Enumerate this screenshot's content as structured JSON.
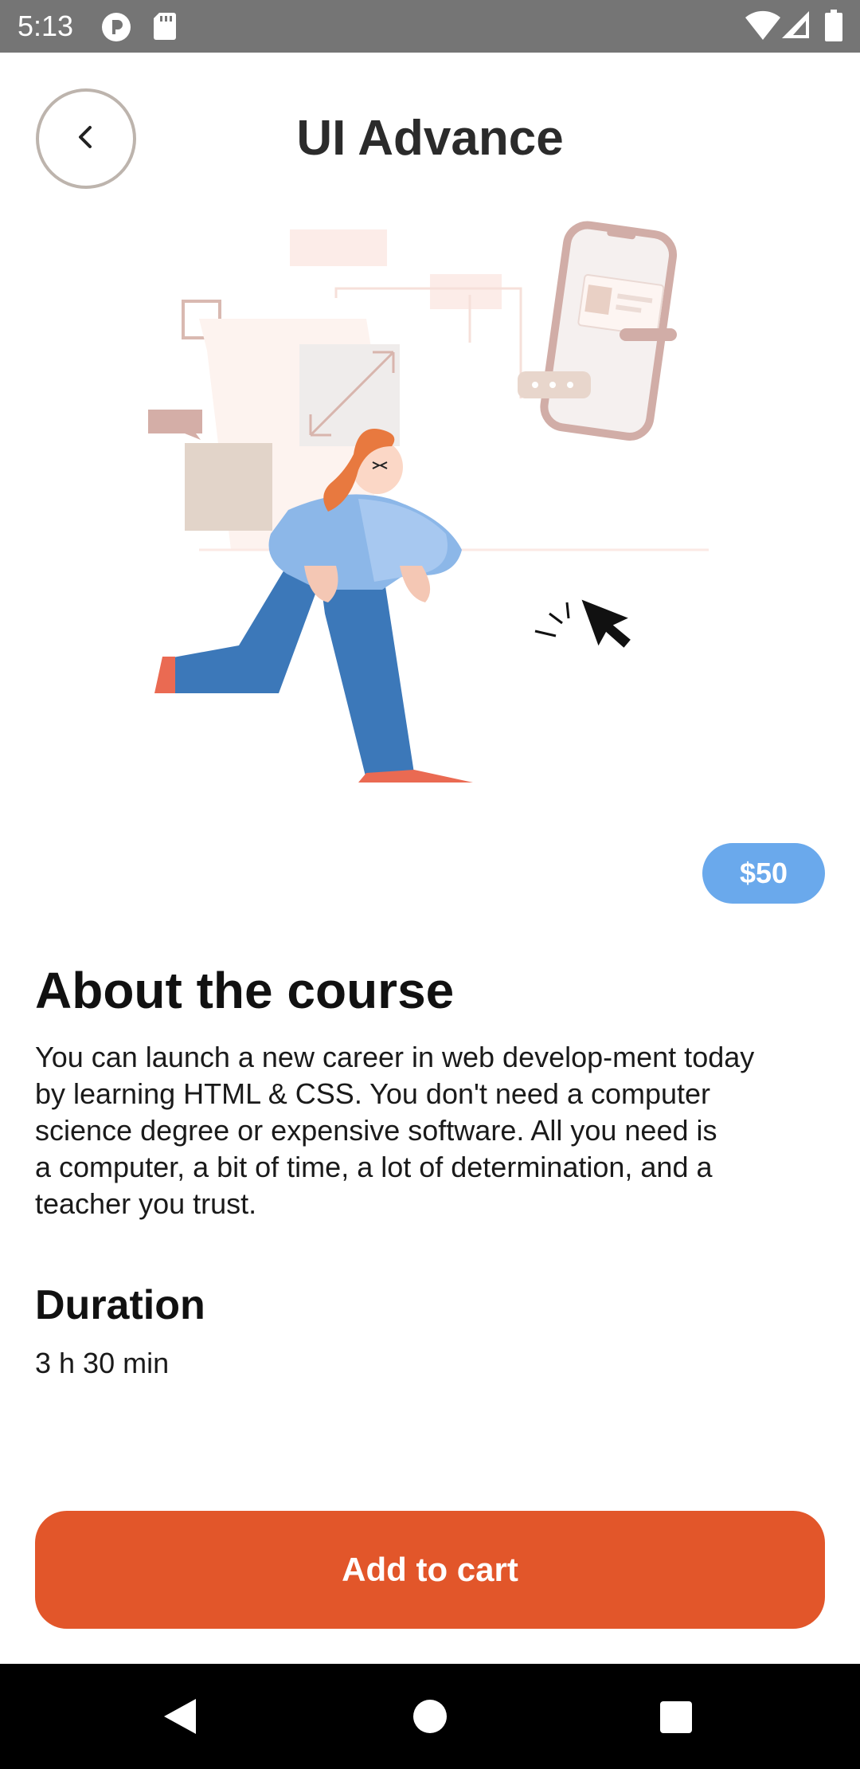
{
  "status_bar": {
    "time": "5:13",
    "icons": [
      "notification-p-icon",
      "sd-card-icon",
      "wifi-icon",
      "cellular-signal-icon",
      "battery-icon"
    ]
  },
  "header": {
    "title": "UI Advance",
    "back_icon": "chevron-left-icon"
  },
  "illustration": {
    "subject": "person-with-phone-illustration"
  },
  "price": "$50",
  "about": {
    "heading": "About the course",
    "line1": "You can launch a new career in web develop-ment today",
    "line2": "by learning HTML & CSS. You don't need a computer",
    "line3": "science degree or expensive software. All you need is",
    "line4": "a computer, a bit of time, a lot of determination, and a",
    "line5": "teacher you trust."
  },
  "duration": {
    "heading": "Duration",
    "value": "3 h 30 min"
  },
  "cta": {
    "label": "Add to cart"
  },
  "colors": {
    "accent": "#e2562a",
    "price_badge": "#6aa9ec",
    "status_bar": "#757575",
    "nav_bar": "#000000"
  },
  "nav": [
    "back-triangle-icon",
    "home-circle-icon",
    "recents-square-icon"
  ]
}
